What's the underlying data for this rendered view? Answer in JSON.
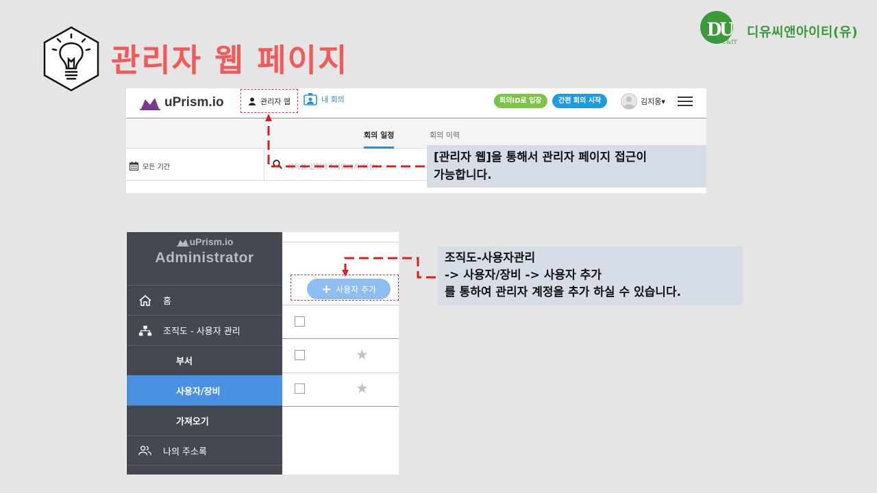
{
  "slide": {
    "title": "관리자 웹 페이지",
    "title_color": "#f05a5a",
    "lightbulb_icon": "lightbulb-hexagon-icon"
  },
  "company": {
    "logo_mark": "DU",
    "name": "디유씨앤아이티(유)",
    "sub": "C&IT",
    "color": "#3a9a3a"
  },
  "screenshot1": {
    "brand": "uPrism.io",
    "admin_web": "관리자 웹",
    "my_meeting": "내 회의",
    "join_by_id": "회의ID로 입장",
    "quick_start": "간편 회의 시작",
    "user_name": "김지웅▾",
    "tabs": [
      {
        "label": "회의 일정",
        "active": true
      },
      {
        "label": "회의 이력",
        "active": false
      }
    ],
    "period": "모든 기간",
    "search_placeholder": "제목을 입력해주세요(2자 이상)"
  },
  "callout1": {
    "line1": "[관리자 웹]을 통해서 관리자 페이지 접근이",
    "line2": "가능합니다."
  },
  "screenshot2": {
    "brand_small": "uPrism.io",
    "brand_big": "Administrator",
    "menu": [
      {
        "label": "홈",
        "icon": "home-icon"
      },
      {
        "label": "조직도 - 사용자 관리",
        "icon": "org-chart-icon"
      },
      {
        "label": "부서",
        "sub": true
      },
      {
        "label": "사용자/장비",
        "sub": true,
        "active": true
      },
      {
        "label": "가져오기",
        "sub": true
      },
      {
        "label": "나의 주소록",
        "icon": "people-icon"
      }
    ],
    "add_user_button": "사용자 추가",
    "accent": "#4a90e2"
  },
  "callout2": {
    "line1": "조직도-사용자관리",
    "line2": "-> 사용자/장비 -> 사용자 추가",
    "line3": "를 통하여 관리자 계정을 추가 하실 수 있습니다."
  }
}
